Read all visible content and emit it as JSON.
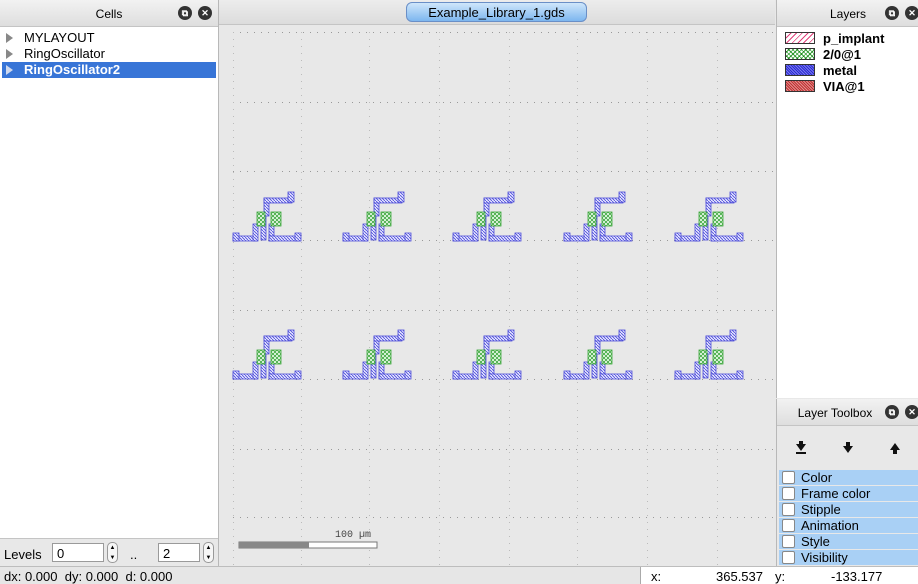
{
  "cells_panel": {
    "title": "Cells",
    "items": [
      "MYLAYOUT",
      "RingOscillator",
      "RingOscillator2"
    ],
    "selected_index": 2
  },
  "levels": {
    "label": "Levels",
    "from": "0",
    "separator": "..",
    "to": "2"
  },
  "canvas": {
    "tab": "Example_Library_1.gds",
    "scale_label": "100 µm",
    "oscillator_rows": 2,
    "oscillator_cols": 5
  },
  "layers_panel": {
    "title": "Layers",
    "items": [
      {
        "name": "p_implant",
        "color": "#e0407a"
      },
      {
        "name": "2/0@1",
        "color": "#3aa53a"
      },
      {
        "name": "metal",
        "color": "#2a2ad0"
      },
      {
        "name": "VIA@1",
        "color": "#c03030"
      }
    ]
  },
  "toolbox": {
    "title": "Layer Toolbox",
    "items": [
      "Color",
      "Frame color",
      "Stipple",
      "Animation",
      "Style",
      "Visibility"
    ]
  },
  "status": {
    "dx": "dx: 0.000",
    "dy": "dy: 0.000",
    "d": "d: 0.000",
    "x_label": "x:",
    "x_value": "365.537",
    "y_label": "y:",
    "y_value": "-133.177"
  }
}
